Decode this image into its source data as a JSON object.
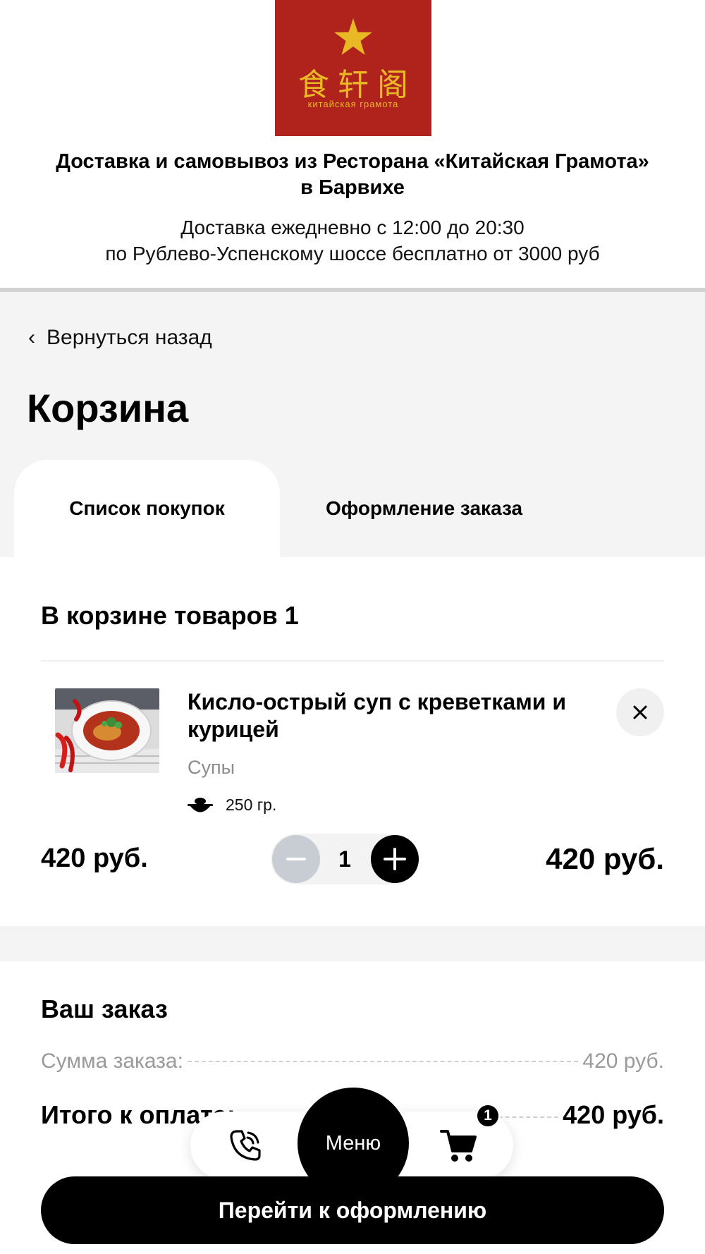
{
  "header": {
    "logo": {
      "hanzi": "食轩阁",
      "caption": "китайская грамота",
      "bg_color": "#b0221c",
      "accent_color": "#e8b924"
    },
    "title_line1": "Доставка и самовывоз из Ресторана «Китайская Грамота»",
    "title_line2": "в Барвихе",
    "subtitle_line1": "Доставка ежедневно с 12:00 до 20:30",
    "subtitle_line2": "по Рублево-Успенскому шоссе бесплатно от 3000 руб"
  },
  "nav": {
    "back_label": "Вернуться назад",
    "back_icon": "chevron-left-icon"
  },
  "page": {
    "title": "Корзина"
  },
  "tabs": [
    {
      "label": "Список покупок",
      "active": true
    },
    {
      "label": "Оформление заказа",
      "active": false
    }
  ],
  "cart": {
    "count_label": "В корзине товаров 1",
    "items": [
      {
        "name": "Кисло-острый суп с креветками и курицей",
        "category": "Супы",
        "weight": "250 гр.",
        "unit_price": "420 руб.",
        "quantity": "1",
        "total": "420 руб."
      }
    ]
  },
  "summary": {
    "title": "Ваш заказ",
    "subtotal_label": "Сумма заказа:",
    "subtotal_value": "420 руб.",
    "total_label": "Итого к оплате:",
    "total_value": "420 руб."
  },
  "bottom_nav": {
    "menu_label": "Меню",
    "cart_badge": "1",
    "phone_icon": "phone-icon",
    "cart_icon": "cart-icon"
  },
  "checkout_button": "Перейти к оформлению"
}
